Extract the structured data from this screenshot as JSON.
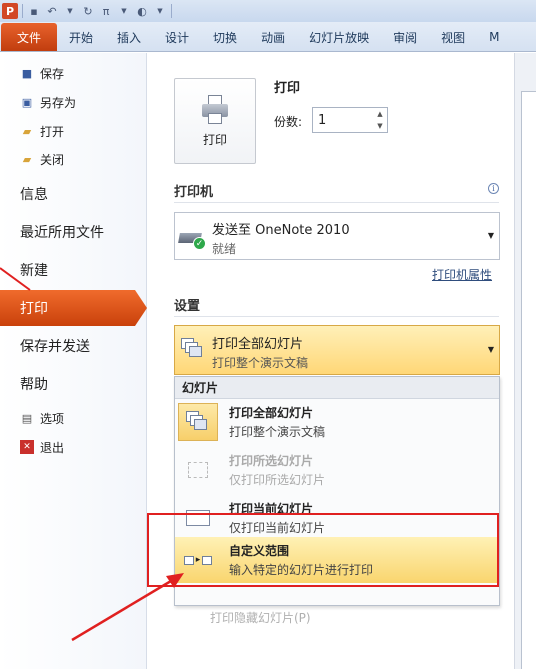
{
  "app": {
    "icon_letter": "P"
  },
  "qat": {
    "items": [
      "save-icon",
      "undo-icon",
      "redo-icon",
      "pi-icon",
      "shape-icon",
      "customize-icon"
    ],
    "pi_label": "π"
  },
  "ribbon": {
    "tabs": [
      "文件",
      "开始",
      "插入",
      "设计",
      "切换",
      "动画",
      "幻灯片放映",
      "审阅",
      "视图",
      "M"
    ]
  },
  "nav": {
    "save": "保存",
    "save_as": "另存为",
    "open": "打开",
    "close": "关闭",
    "info": "信息",
    "recent": "最近所用文件",
    "new": "新建",
    "print": "打印",
    "save_send": "保存并发送",
    "help": "帮助",
    "options": "选项",
    "exit": "退出"
  },
  "print": {
    "button_label": "打印",
    "heading": "打印",
    "copies_label": "份数:",
    "copies_value": "1"
  },
  "printer": {
    "section_title": "打印机",
    "name": "发送至 OneNote 2010",
    "status": "就绪",
    "properties_link": "打印机属性"
  },
  "settings": {
    "section_title": "设置",
    "selected_title": "打印全部幻灯片",
    "selected_desc": "打印整个演示文稿"
  },
  "dropdown": {
    "header": "幻灯片",
    "items": [
      {
        "title": "打印全部幻灯片",
        "desc": "打印整个演示文稿"
      },
      {
        "title": "打印所选幻灯片",
        "desc": "仅打印所选幻灯片"
      },
      {
        "title": "打印当前幻灯片",
        "desc": "仅打印当前幻灯片"
      },
      {
        "title": "自定义范围",
        "desc": "输入特定的幻灯片进行打印"
      }
    ],
    "hidden_item": "打印隐藏幻灯片(P)"
  },
  "colors": {
    "file_tab": "#d24726",
    "active_nav": "#e85a1e",
    "highlight": "#f9d56e",
    "annotation_red": "#e02020"
  }
}
